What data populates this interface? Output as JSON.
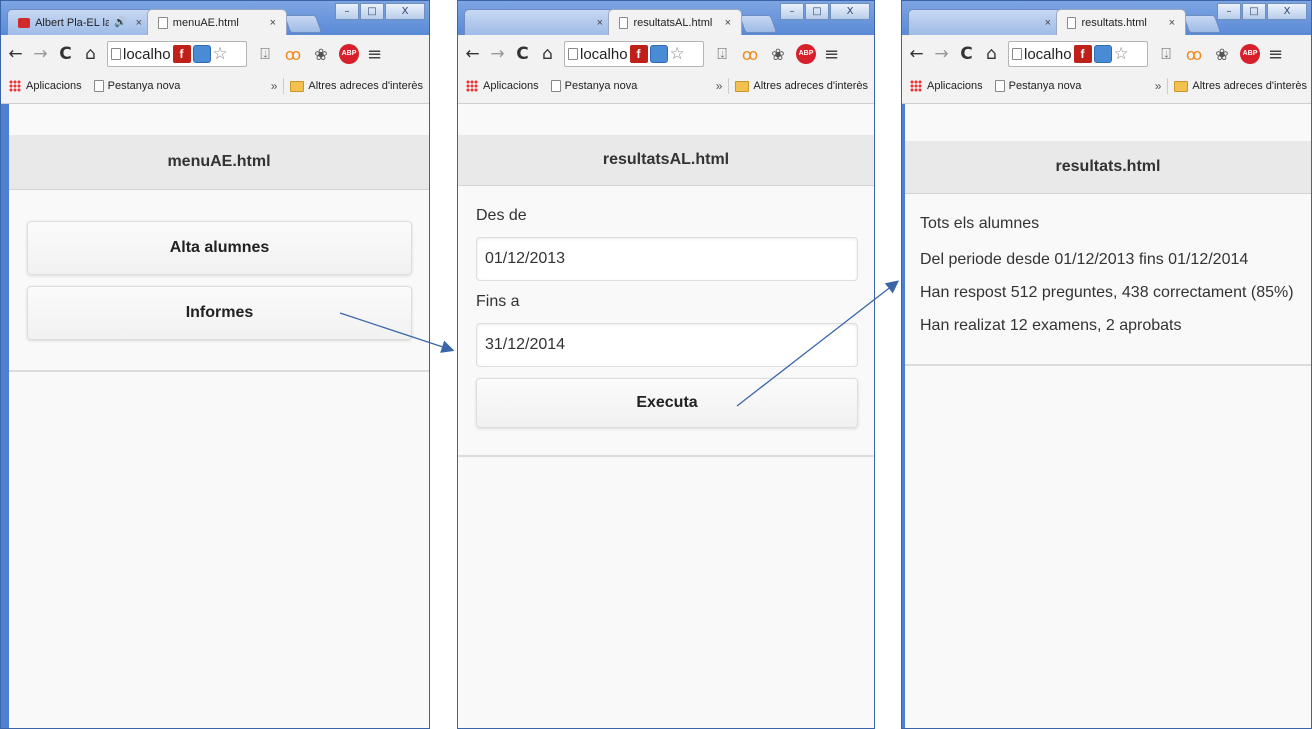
{
  "colors": {
    "frame": "#4f7fd0",
    "arrow": "#3a66a8",
    "header_bg": "#e9e9e9"
  },
  "windows": [
    {
      "tabs": [
        {
          "title": "Albert Pla-EL la",
          "close": "×",
          "icon": "youtube-icon"
        },
        {
          "title": "menuAE.html",
          "close": "×",
          "icon": "page-icon"
        }
      ],
      "omnibox": {
        "text": "localho"
      },
      "bookmarks": {
        "apps": "Aplicacions",
        "new_tab": "Pestanya nova",
        "more": "»",
        "other": "Altres adreces d'interès"
      },
      "page": {
        "header": "menuAE.html",
        "buttons": [
          "Alta alumnes",
          "Informes"
        ]
      }
    },
    {
      "tabs": [
        {
          "title": "",
          "close": "×"
        },
        {
          "title": "resultatsAL.html",
          "close": "×",
          "icon": "page-icon"
        }
      ],
      "omnibox": {
        "text": "localho"
      },
      "bookmarks": {
        "apps": "Aplicacions",
        "new_tab": "Pestanya nova",
        "more": "»",
        "other": "Altres adreces d'interès"
      },
      "page": {
        "header": "resultatsAL.html",
        "from_label": "Des de",
        "from_value": "01/12/2013",
        "to_label": "Fins a",
        "to_value": "31/12/2014",
        "execute": "Executa"
      }
    },
    {
      "tabs": [
        {
          "title": "",
          "close": "×"
        },
        {
          "title": "resultats.html",
          "close": "×",
          "icon": "page-icon"
        }
      ],
      "omnibox": {
        "text": "localho"
      },
      "bookmarks": {
        "apps": "Aplicacions",
        "new_tab": "Pestanya nova",
        "more": "»",
        "other": "Altres adreces d'interès"
      },
      "page": {
        "header": "resultats.html",
        "lines": [
          "Tots els alumnes",
          "Del periode desde 01/12/2013 fins 01/12/2014",
          "Han respost 512 preguntes, 438 correctament (85%)",
          "Han realizat 12 examens, 2 aprobats"
        ]
      }
    }
  ],
  "window_controls": {
    "minimize": "–",
    "maximize": "□",
    "close": "X"
  },
  "nav_glyphs": {
    "back": "←",
    "forward": "→",
    "reload": "C",
    "home": "⌂",
    "star": "☆",
    "menu": "≡",
    "flash": "f",
    "abp": "ABP"
  }
}
